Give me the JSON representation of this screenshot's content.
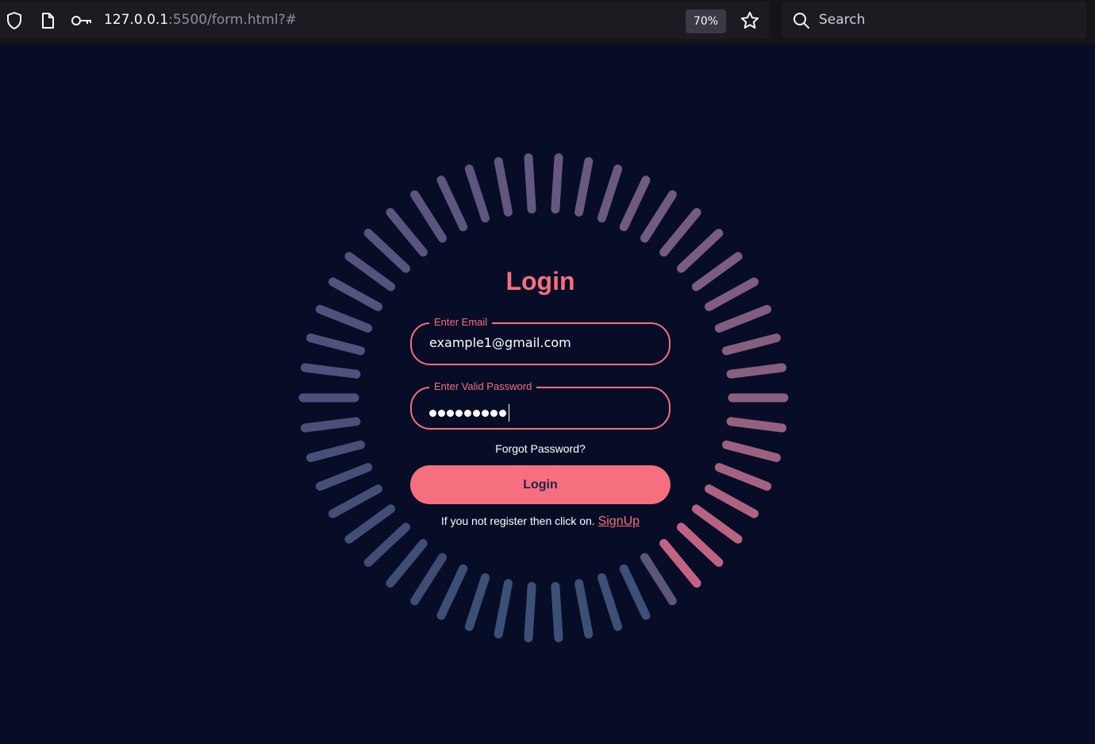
{
  "browser": {
    "url_host": "127.0.0.1",
    "url_rest": ":5500/form.html?#",
    "zoom": "70%",
    "search_placeholder": "Search",
    "icons": [
      "shield-icon",
      "page-icon",
      "key-icon",
      "star-icon",
      "search-icon"
    ]
  },
  "login": {
    "title": "Login",
    "email_label": "Enter Email",
    "email_value": "example1@gmail.com",
    "password_label": "Enter Valid Password",
    "password_length": 9,
    "forgot": "Forgot Password?",
    "button": "Login",
    "signup_prompt": "If you not register then click on.",
    "signup_link": "SignUp"
  },
  "colors": {
    "background": "#070d26",
    "accent": "#f56f7e",
    "ring_dim": "#4a4f78",
    "ring_pink": "#c45f7f"
  }
}
